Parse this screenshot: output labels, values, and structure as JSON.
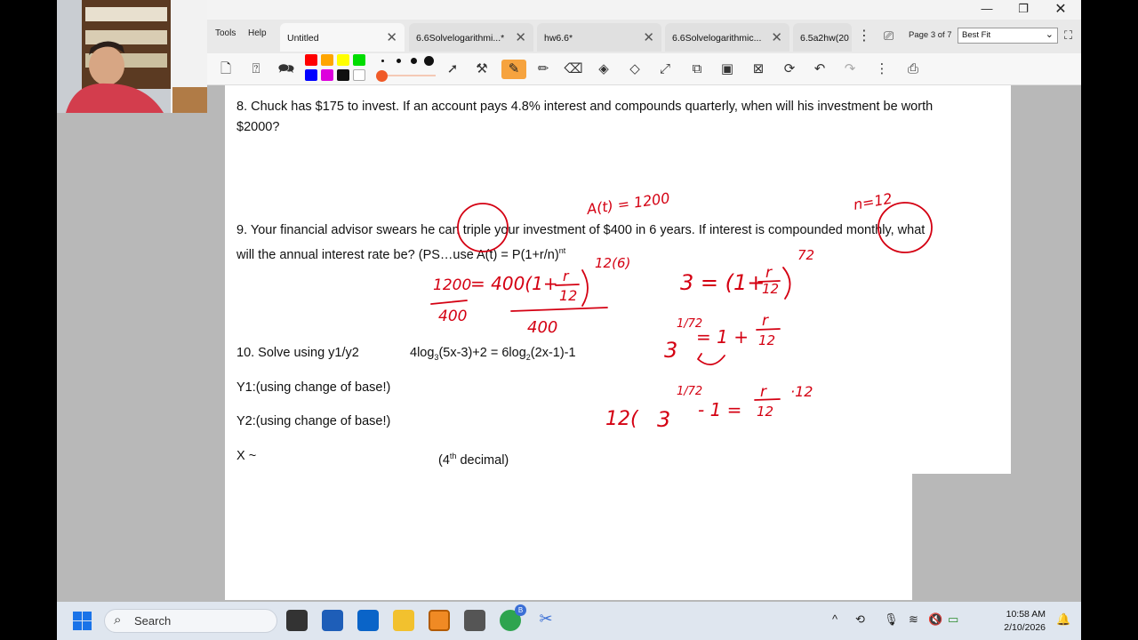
{
  "tabs": {
    "menu": [
      "Tools",
      "Help"
    ],
    "items": [
      {
        "label": "Untitled"
      },
      {
        "label": "6.6Solvelogarithmi...*"
      },
      {
        "label": "hw6.6*"
      },
      {
        "label": "6.6Solvelogarithmic..."
      },
      {
        "label": "6.5a2hw(20"
      }
    ],
    "page_info": "Page 3 of 7",
    "zoom": "Best Fit"
  },
  "toolbar": {
    "colors": [
      "#ff0000",
      "#ffa500",
      "#ffff00",
      "#00dd00",
      "#0000ff",
      "#dd00dd",
      "#111111",
      "#ffffff"
    ],
    "active_tool": "pen-icon"
  },
  "document": {
    "q8_line1": "8. Chuck has $175 to invest. If an account pays 4.8% interest and compounds  quarterly, when will his investment be worth",
    "q8_line2": "$2000?",
    "q9_line1": "9. Your financial advisor swears he can triple your investment of $400 in 6 years. If interest is compounded monthly, what",
    "q9_line2a": "will the annual interest rate be? (PS…use A(t) = P(1+r/n)",
    "q9_line2_sup": "nt",
    "q10_label": "10. Solve using y1/y2",
    "q10_eq_a": "4log",
    "q10_eq_sub1": "3",
    "q10_eq_b": "(5x-3)+2 = 6log",
    "q10_eq_sub2": "2",
    "q10_eq_c": "(2x-1)-1",
    "y1": "Y1:(using change of base!)",
    "y2": "Y2:(using change of base!)",
    "x_label": "X ~",
    "decimal_a": "(4",
    "decimal_sup": "th",
    "decimal_b": " decimal)"
  },
  "ink": {
    "a_t": "A(t) = 1200",
    "n_eq": "n=12",
    "eq1_left": "1200",
    "eq1_left_den": "400",
    "eq1_mid": "= 400(1+",
    "eq1_frac_num": "r",
    "eq1_frac_den": "12",
    "eq1_exp": "12(6)",
    "eq1_den": "400",
    "eq2_left": "3 = (1+",
    "eq2_num": "r",
    "eq2_den": "12",
    "eq2_exp": "72",
    "eq3_base": "3",
    "eq3_exp": "1/72",
    "eq3_rhs": "= 1 +",
    "eq3_num": "r",
    "eq3_den": "12",
    "eq4_pre": "12(",
    "eq4_base": "3",
    "eq4_exp": "1/72",
    "eq4_mid": "- 1 =",
    "eq4_num": "r",
    "eq4_den": "12",
    "eq4_post": "·12"
  },
  "taskbar": {
    "search_placeholder": "Search",
    "time": "10:58 AM",
    "date": "2/10/2026",
    "chrome_badge": "B"
  }
}
